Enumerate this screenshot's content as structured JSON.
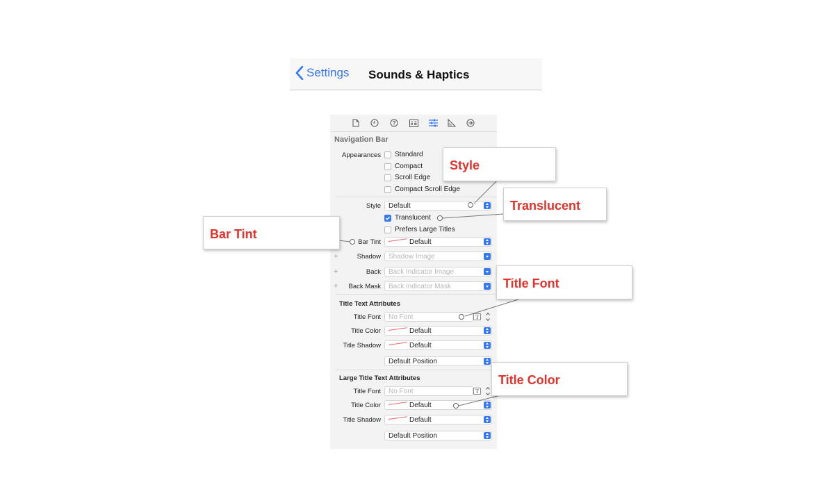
{
  "nav_preview": {
    "back_label": "Settings",
    "title": "Sounds & Haptics",
    "accent_color": "#3478f6"
  },
  "inspector": {
    "toolbar_icons": [
      "file-icon",
      "history-icon",
      "help-icon",
      "identity-icon",
      "attributes-icon",
      "size-icon",
      "connections-icon"
    ],
    "section_title": "Navigation Bar",
    "appearances": {
      "label": "Appearances",
      "options": [
        {
          "label": "Standard",
          "checked": false
        },
        {
          "label": "Compact",
          "checked": false
        },
        {
          "label": "Scroll Edge",
          "checked": false
        },
        {
          "label": "Compact Scroll Edge",
          "checked": false
        }
      ]
    },
    "style": {
      "label": "Style",
      "value": "Default"
    },
    "translucent": {
      "label": "Translucent",
      "checked": true
    },
    "prefers_large_titles": {
      "label": "Prefers Large Titles",
      "checked": false
    },
    "bar_tint": {
      "label": "Bar Tint",
      "value": "Default"
    },
    "shadow": {
      "label": "Shadow",
      "placeholder": "Shadow Image"
    },
    "back": {
      "label": "Back",
      "placeholder": "Back Indicator Image"
    },
    "back_mask": {
      "label": "Back Mask",
      "placeholder": "Back Indicator Mask"
    },
    "title_text_attributes": {
      "heading": "Title Text Attributes",
      "title_font": {
        "label": "Title Font",
        "placeholder": "No Font"
      },
      "title_color": {
        "label": "Title Color",
        "value": "Default"
      },
      "title_shadow": {
        "label": "Title Shadow",
        "value": "Default"
      },
      "position": "Default Position"
    },
    "large_title_text_attributes": {
      "heading": "Large Title Text Attributes",
      "title_font": {
        "label": "Title Font",
        "placeholder": "No Font"
      },
      "title_color": {
        "label": "Title Color",
        "value": "Default"
      },
      "title_shadow": {
        "label": "Title Shadow",
        "value": "Default"
      },
      "position": "Default Position"
    },
    "font_button_glyph": "T"
  },
  "callouts": {
    "style": "Style",
    "translucent": "Translucent",
    "bar_tint": "Bar Tint",
    "title_font": "Title Font",
    "title_color": "Title Color",
    "text_color": "#e8302a"
  }
}
